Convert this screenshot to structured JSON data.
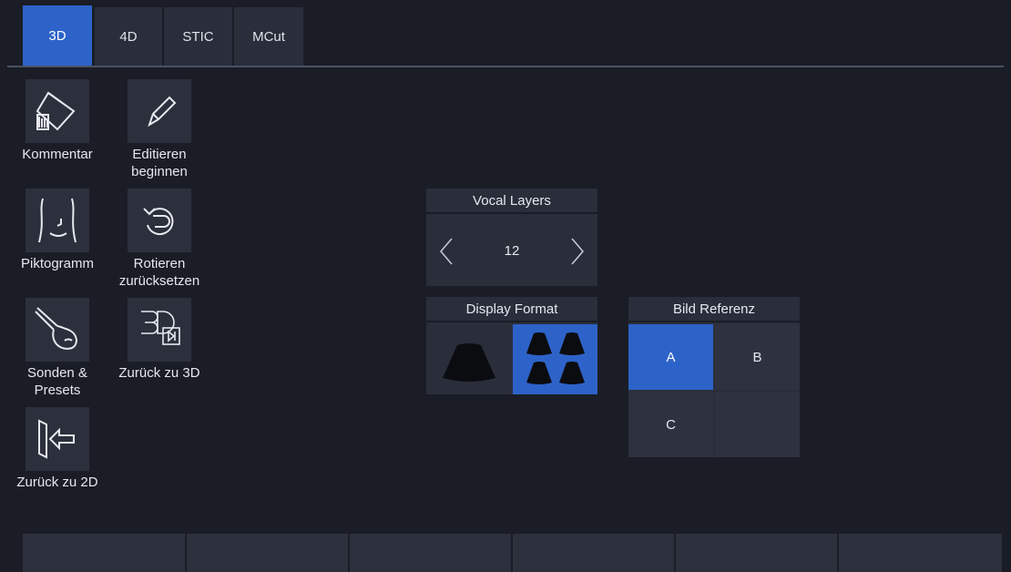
{
  "tabs": [
    {
      "label": "3D",
      "active": true
    },
    {
      "label": "4D",
      "active": false
    },
    {
      "label": "STIC",
      "active": false
    },
    {
      "label": "MCut",
      "active": false
    }
  ],
  "tools": {
    "comment": {
      "label": "Kommentar",
      "icon": "comment-annotation-icon"
    },
    "edit": {
      "label": "Editieren\nbeginnen",
      "icon": "pencil-icon"
    },
    "pictogram": {
      "label": "Piktogramm",
      "icon": "body-pictogram-icon"
    },
    "reset_rotation": {
      "label": "Rotieren\nzurücksetzen",
      "icon": "rotate-reset-icon"
    },
    "probes": {
      "label": "Sonden &\nPresets",
      "icon": "probe-icon"
    },
    "back_3d": {
      "label": "Zurück zu 3D",
      "icon": "back-to-3d-icon"
    },
    "back_2d": {
      "label": "Zurück zu 2D",
      "icon": "back-to-2d-icon"
    }
  },
  "vocal_layers": {
    "title": "Vocal Layers",
    "value": "12"
  },
  "display_format": {
    "title": "Display Format",
    "options": [
      "single-view",
      "quad-view"
    ],
    "selected": "quad-view"
  },
  "bild_referenz": {
    "title": "Bild Referenz",
    "cells": [
      "A",
      "B",
      "C",
      ""
    ],
    "selected": "A"
  },
  "colors": {
    "accent": "#2d63c8",
    "background": "#1a1d26",
    "panel": "#2a2e3b"
  }
}
